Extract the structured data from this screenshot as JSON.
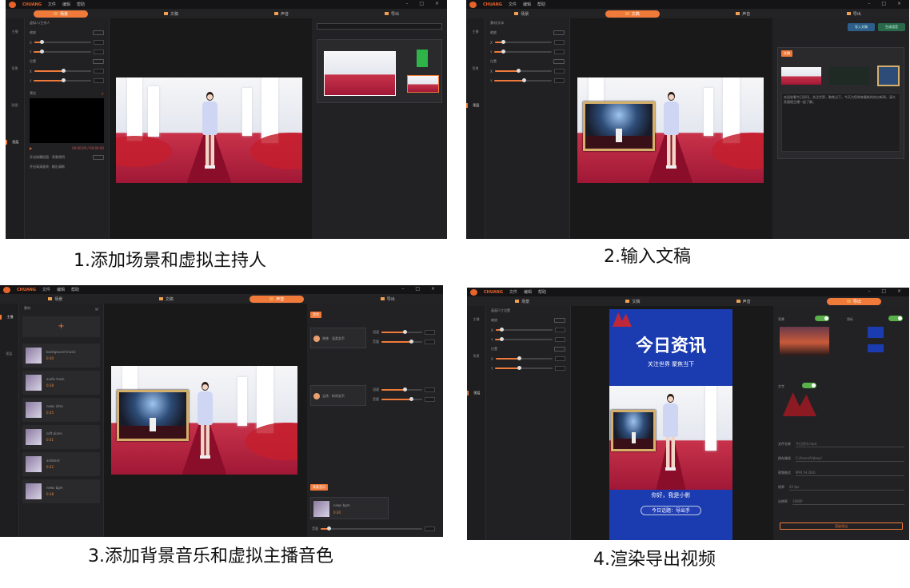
{
  "app": {
    "brand": "CHUANG",
    "menu": [
      "文件",
      "编辑",
      "帮助"
    ],
    "window_controls": "– □ ×",
    "tabs": [
      {
        "label": "场景"
      },
      {
        "label": "文稿"
      },
      {
        "label": "声音"
      },
      {
        "label": "导出"
      }
    ]
  },
  "captions": {
    "step1": "1.添加场景和虚拟主持人",
    "step2": "2.输入文稿",
    "step3": "3.添加背景音乐和虚拟主播音色",
    "step4": "4.渲染导出视频"
  },
  "sidebar": {
    "items": [
      "主播",
      "背景",
      "贴图",
      "图层"
    ]
  },
  "panel1": {
    "title": "虚拟人/主持人",
    "rows": [
      "缩放",
      "X",
      "Y",
      "位置",
      "X",
      "Y"
    ],
    "preview_label": "预览",
    "time": "00:00:00 / 00:00:00",
    "option1": "开启绿幕抠图 · 背景透明",
    "option2": "开启高清画质 · 输出清晰"
  },
  "panel2": {
    "title": "素材/文本",
    "script_tabs": [
      "文稿",
      "导入"
    ],
    "script_text": "欢迎收看今日资讯，关注世界，聚焦当下。今天为您带来最新的热点新闻，请大家跟随主播一起了解。",
    "import_button": "导入文稿",
    "generate_button": "生成语音"
  },
  "panel3": {
    "list_title": "素材",
    "tracks": [
      {
        "name": "background music",
        "meta": "0:30"
      },
      {
        "name": "audio track",
        "meta": "0:28"
      },
      {
        "name": "news intro",
        "meta": "0:25"
      },
      {
        "name": "soft piano",
        "meta": "0:31"
      },
      {
        "name": "ambient",
        "meta": "0:22"
      },
      {
        "name": "news bgm",
        "meta": "0:18"
      }
    ],
    "right_title": "音色",
    "voice1": "晓晓 · 温柔女声",
    "voice2": "云扬 · 新闻女声",
    "param1": "语速",
    "param2": "音量",
    "bgm_tag": "背景音乐",
    "bgm_label": "news bgm",
    "bgm_time": "0:30"
  },
  "panel4": {
    "title": "画面尺寸设置",
    "headline": "今日资讯",
    "subline": "关注世界 聚焦当下",
    "anchor_name": "你好，我是小影",
    "lower_tag": "今日话题：导出手",
    "section_bg": "背景",
    "section_logo": "角标",
    "section_text": "文字",
    "form": [
      {
        "label": "文件名称",
        "value": "今日资讯.mp4"
      },
      {
        "label": "保存路径",
        "value": "C:/Users/Videos/"
      },
      {
        "label": "视频格式",
        "value": "MP4 (H.264)"
      },
      {
        "label": "帧率",
        "value": "25 fps"
      },
      {
        "label": "分辨率",
        "value": "1080P"
      }
    ],
    "export_button": "渲染导出"
  }
}
